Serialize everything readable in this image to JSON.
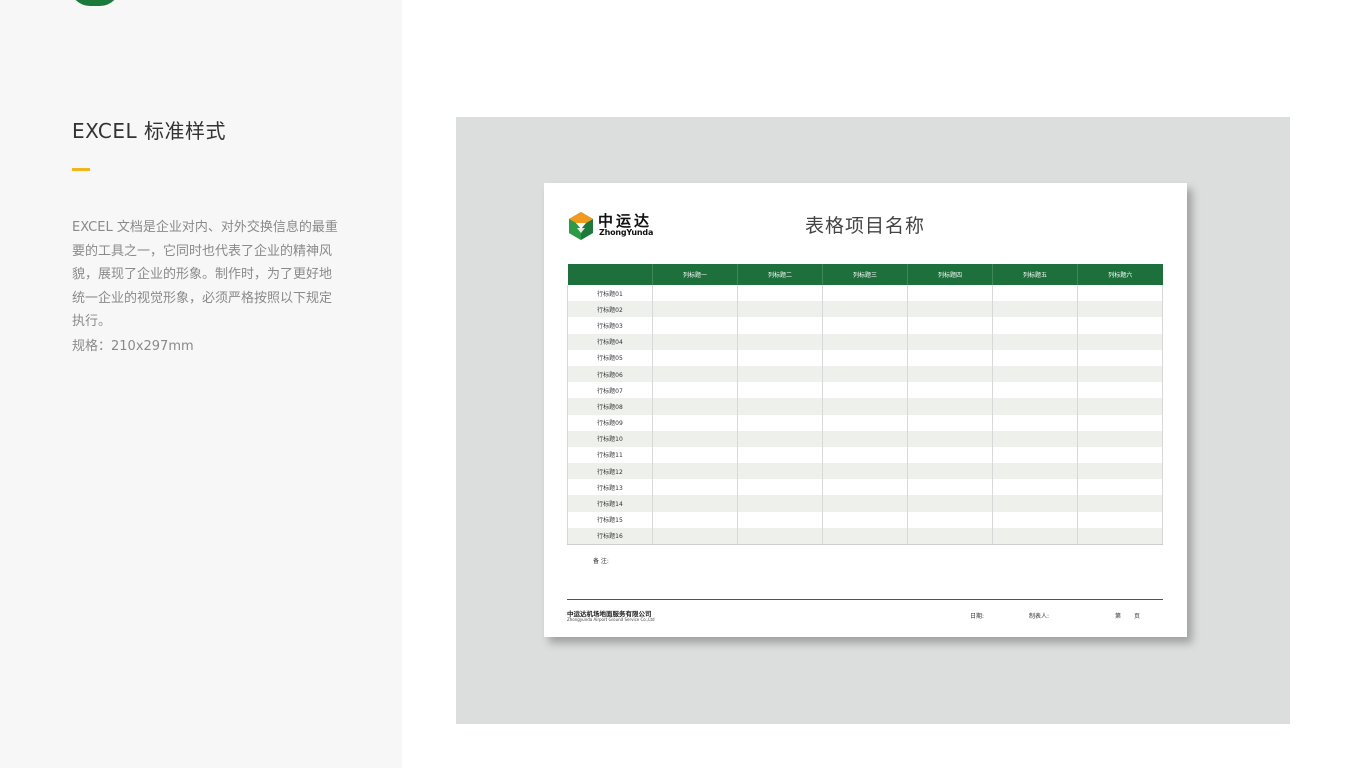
{
  "left": {
    "title": "EXCEL 标准样式",
    "description": "EXCEL 文档是企业对内、对外交换信息的最重要的工具之一，它同时也代表了企业的精神风貌，展现了企业的形象。制作时，为了更好地统一企业的视觉形象，必须严格按照以下规定执行。",
    "spec": "规格：210x297mm",
    "accent_color": "#f2b51c"
  },
  "document": {
    "logo": {
      "name_cn": "中运达",
      "name_en": "ZhongYunda",
      "icon": "hexagon-logo-icon"
    },
    "title": "表格项目名称",
    "brand_color": "#1d6f3b",
    "columns": [
      "",
      "列标题一",
      "列标题二",
      "列标题三",
      "列标题四",
      "列标题五",
      "列标题六"
    ],
    "rows": [
      "行标题01",
      "行标题02",
      "行标题03",
      "行标题04",
      "行标题05",
      "行标题06",
      "行标题07",
      "行标题08",
      "行标题09",
      "行标题10",
      "行标题11",
      "行标题12",
      "行标题13",
      "行标题14",
      "行标题15",
      "行标题16"
    ],
    "note_label": "备 注:",
    "footer": {
      "company_cn": "中运达机场地面服务有限公司",
      "company_en": "Zhongyunda Airport Ground Service Co.,Ltd",
      "date_label": "日期:",
      "author_label": "制表人:",
      "page_prefix": "第",
      "page_suffix": "页"
    }
  }
}
